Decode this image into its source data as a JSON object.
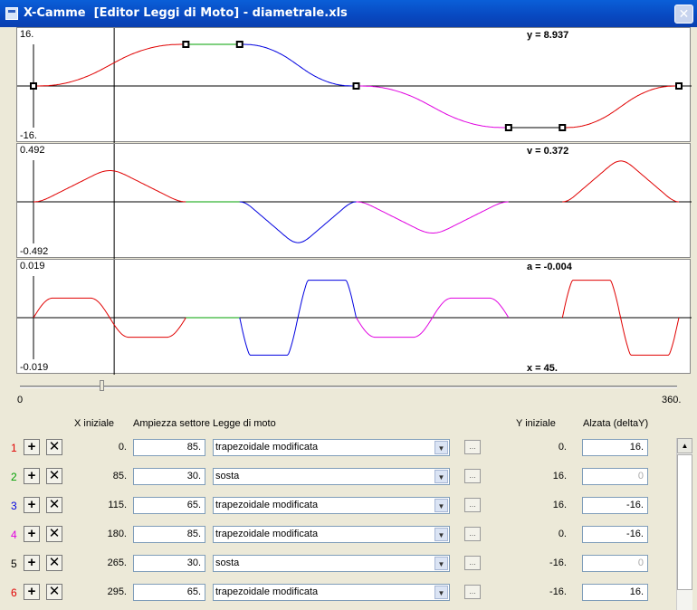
{
  "window": {
    "title": "X-Camme  [Editor Leggi di Moto] - diametrale.xls",
    "close_glyph": "✕",
    "icon": "app-window-icon"
  },
  "plots": {
    "y": {
      "max_label": "16.",
      "min_label": "-16.",
      "readout": "y = 8.937"
    },
    "v": {
      "max_label": "0.492",
      "min_label": "-0.492",
      "readout": "v = 0.372"
    },
    "a": {
      "max_label": "0.019",
      "min_label": "-0.019",
      "readout": "a = -0.004",
      "x_readout": "x = 45."
    }
  },
  "slider": {
    "min_label": "0",
    "max_label": "360.",
    "value": 45
  },
  "headers": {
    "x_iniziale": "X iniziale",
    "ampiezza": "Ampiezza settore",
    "legge": "Legge di moto",
    "y_iniziale": "Y iniziale",
    "alzata": "Alzata (deltaY)"
  },
  "colors": {
    "seg1": "#e00000",
    "seg2": "#00a000",
    "seg3": "#0000e0",
    "seg4": "#e000e0",
    "seg5": "#000000",
    "seg6": "#e00000"
  },
  "rows": [
    {
      "n": "1",
      "x": "0.",
      "amp": "85.",
      "law": "trapezoidale modificata",
      "y": "0.",
      "delta": "16.",
      "delta_disabled": false,
      "color": "#e00000"
    },
    {
      "n": "2",
      "x": "85.",
      "amp": "30.",
      "law": "sosta",
      "y": "16.",
      "delta": "0",
      "delta_disabled": true,
      "color": "#00a000"
    },
    {
      "n": "3",
      "x": "115.",
      "amp": "65.",
      "law": "trapezoidale modificata",
      "y": "16.",
      "delta": "-16.",
      "delta_disabled": false,
      "color": "#0000e0"
    },
    {
      "n": "4",
      "x": "180.",
      "amp": "85.",
      "law": "trapezoidale modificata",
      "y": "0.",
      "delta": "-16.",
      "delta_disabled": false,
      "color": "#e000e0"
    },
    {
      "n": "5",
      "x": "265.",
      "amp": "30.",
      "law": "sosta",
      "y": "-16.",
      "delta": "0",
      "delta_disabled": true,
      "color": "#000000"
    },
    {
      "n": "6",
      "x": "295.",
      "amp": "65.",
      "law": "trapezoidale modificata",
      "y": "-16.",
      "delta": "16.",
      "delta_disabled": false,
      "color": "#e00000"
    }
  ],
  "row_buttons": {
    "add": "+",
    "remove": "✕",
    "more": "...",
    "dropdown": "▼"
  }
}
